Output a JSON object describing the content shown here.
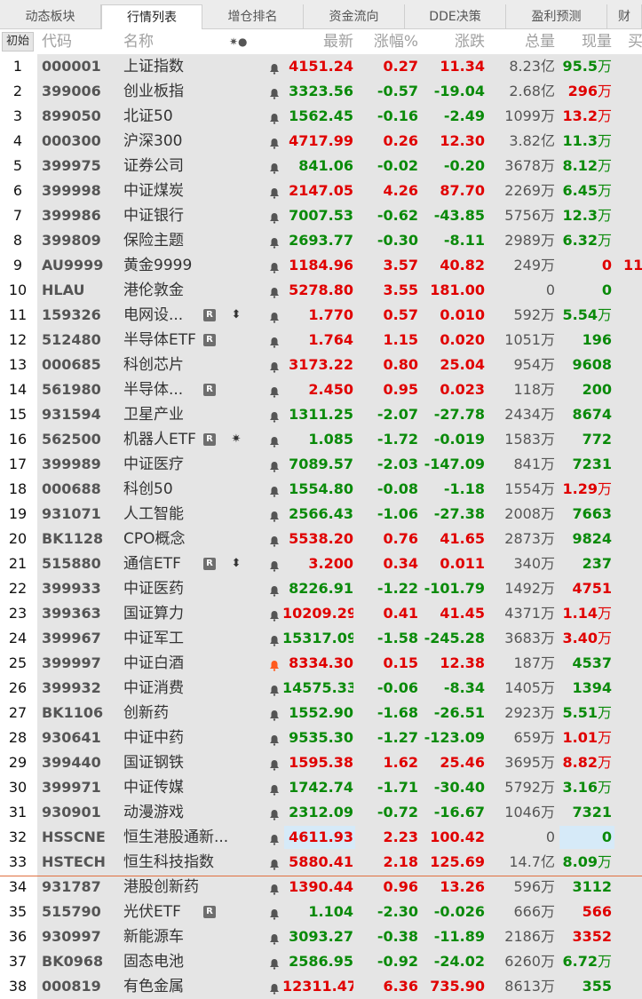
{
  "tabs": [
    "动态板块",
    "行情列表",
    "增仓排名",
    "资金流向",
    "DDE决策",
    "盈利预测",
    "财"
  ],
  "active_tab": 1,
  "header": {
    "sort": "初始",
    "code": "代码",
    "name": "名称",
    "icons": "✷●",
    "last": "最新",
    "pct": "涨幅%",
    "change": "涨跌",
    "volume": "总量",
    "current": "现量",
    "extra": "买"
  },
  "colors": {
    "up": "#e00000",
    "down": "#0a8a0a",
    "row_bg": "#e5e5e5",
    "highlight": "#d6eaf8",
    "alert_bell": "#ff5a1e"
  },
  "rows": [
    {
      "n": "1",
      "code": "000001",
      "name": "上证指数",
      "last": "4151.24",
      "pct": "0.27",
      "chg": "11.34",
      "vol": "8.23亿",
      "cur": "95.5",
      "cur_unit": "万",
      "d": "up",
      "cd": "down"
    },
    {
      "n": "2",
      "code": "399006",
      "name": "创业板指",
      "last": "3323.56",
      "pct": "-0.57",
      "chg": "-19.04",
      "vol": "2.68亿",
      "cur": "296",
      "cur_unit": "万",
      "d": "down",
      "cd": "up"
    },
    {
      "n": "3",
      "code": "899050",
      "name": "北证50",
      "last": "1562.45",
      "pct": "-0.16",
      "chg": "-2.49",
      "vol": "1099万",
      "cur": "13.2",
      "cur_unit": "万",
      "d": "down",
      "cd": "up"
    },
    {
      "n": "4",
      "code": "000300",
      "name": "沪深300",
      "last": "4717.99",
      "pct": "0.26",
      "chg": "12.30",
      "vol": "3.82亿",
      "cur": "11.3",
      "cur_unit": "万",
      "d": "up",
      "cd": "down"
    },
    {
      "n": "5",
      "code": "399975",
      "name": "证券公司",
      "last": "841.06",
      "pct": "-0.02",
      "chg": "-0.20",
      "vol": "3678万",
      "cur": "8.12",
      "cur_unit": "万",
      "d": "down",
      "cd": "down"
    },
    {
      "n": "6",
      "code": "399998",
      "name": "中证煤炭",
      "last": "2147.05",
      "pct": "4.26",
      "chg": "87.70",
      "vol": "2269万",
      "cur": "6.45",
      "cur_unit": "万",
      "d": "up",
      "cd": "down"
    },
    {
      "n": "7",
      "code": "399986",
      "name": "中证银行",
      "last": "7007.53",
      "pct": "-0.62",
      "chg": "-43.85",
      "vol": "5756万",
      "cur": "12.3",
      "cur_unit": "万",
      "d": "down",
      "cd": "down"
    },
    {
      "n": "8",
      "code": "399809",
      "name": "保险主题",
      "last": "2693.77",
      "pct": "-0.30",
      "chg": "-8.11",
      "vol": "2989万",
      "cur": "6.32",
      "cur_unit": "万",
      "d": "down",
      "cd": "down"
    },
    {
      "n": "9",
      "code": "AU9999",
      "name": "黄金9999",
      "last": "1184.96",
      "pct": "3.57",
      "chg": "40.82",
      "vol": "249万",
      "cur": "0",
      "cur_unit": "",
      "d": "up",
      "cd": "up",
      "extra": "11"
    },
    {
      "n": "10",
      "code": "HLAU",
      "name": "港伦敦金",
      "last": "5278.80",
      "pct": "3.55",
      "chg": "181.00",
      "vol": "0",
      "cur": "0",
      "cur_unit": "",
      "d": "up",
      "cd": "down"
    },
    {
      "n": "11",
      "code": "159326",
      "name": "电网设...",
      "badge": "R",
      "sym": "⬍",
      "last": "1.770",
      "pct": "0.57",
      "chg": "0.010",
      "vol": "592万",
      "cur": "5.54",
      "cur_unit": "万",
      "d": "up",
      "cd": "down"
    },
    {
      "n": "12",
      "code": "512480",
      "name": "半导体ETF",
      "badge": "R",
      "last": "1.764",
      "pct": "1.15",
      "chg": "0.020",
      "vol": "1051万",
      "cur": "196",
      "cur_unit": "",
      "d": "up",
      "cd": "down"
    },
    {
      "n": "13",
      "code": "000685",
      "name": "科创芯片",
      "last": "3173.22",
      "pct": "0.80",
      "chg": "25.04",
      "vol": "954万",
      "cur": "9608",
      "cur_unit": "",
      "d": "up",
      "cd": "down"
    },
    {
      "n": "14",
      "code": "561980",
      "name": "半导体...",
      "badge": "R",
      "last": "2.450",
      "pct": "0.95",
      "chg": "0.023",
      "vol": "118万",
      "cur": "200",
      "cur_unit": "",
      "d": "up",
      "cd": "down"
    },
    {
      "n": "15",
      "code": "931594",
      "name": "卫星产业",
      "last": "1311.25",
      "pct": "-2.07",
      "chg": "-27.78",
      "vol": "2434万",
      "cur": "8674",
      "cur_unit": "",
      "d": "down",
      "cd": "down"
    },
    {
      "n": "16",
      "code": "562500",
      "name": "机器人ETF",
      "badge": "R",
      "sym": "✷",
      "last": "1.085",
      "pct": "-1.72",
      "chg": "-0.019",
      "vol": "1583万",
      "cur": "772",
      "cur_unit": "",
      "d": "down",
      "cd": "down"
    },
    {
      "n": "17",
      "code": "399989",
      "name": "中证医疗",
      "last": "7089.57",
      "pct": "-2.03",
      "chg": "-147.09",
      "vol": "841万",
      "cur": "7231",
      "cur_unit": "",
      "d": "down",
      "cd": "down"
    },
    {
      "n": "18",
      "code": "000688",
      "name": "科创50",
      "last": "1554.80",
      "pct": "-0.08",
      "chg": "-1.18",
      "vol": "1554万",
      "cur": "1.29",
      "cur_unit": "万",
      "d": "down",
      "cd": "up"
    },
    {
      "n": "19",
      "code": "931071",
      "name": "人工智能",
      "last": "2566.43",
      "pct": "-1.06",
      "chg": "-27.38",
      "vol": "2008万",
      "cur": "7663",
      "cur_unit": "",
      "d": "down",
      "cd": "down"
    },
    {
      "n": "20",
      "code": "BK1128",
      "name": "CPO概念",
      "last": "5538.20",
      "pct": "0.76",
      "chg": "41.65",
      "vol": "2873万",
      "cur": "9824",
      "cur_unit": "",
      "d": "up",
      "cd": "down"
    },
    {
      "n": "21",
      "code": "515880",
      "name": "通信ETF",
      "badge": "R",
      "sym": "⬍",
      "last": "3.200",
      "pct": "0.34",
      "chg": "0.011",
      "vol": "340万",
      "cur": "237",
      "cur_unit": "",
      "d": "up",
      "cd": "down"
    },
    {
      "n": "22",
      "code": "399933",
      "name": "中证医药",
      "last": "8226.91",
      "pct": "-1.22",
      "chg": "-101.79",
      "vol": "1492万",
      "cur": "4751",
      "cur_unit": "",
      "d": "down",
      "cd": "up"
    },
    {
      "n": "23",
      "code": "399363",
      "name": "国证算力",
      "last": "10209.29",
      "pct": "0.41",
      "chg": "41.45",
      "vol": "4371万",
      "cur": "1.14",
      "cur_unit": "万",
      "d": "up",
      "cd": "up"
    },
    {
      "n": "24",
      "code": "399967",
      "name": "中证军工",
      "last": "15317.09",
      "pct": "-1.58",
      "chg": "-245.28",
      "vol": "3683万",
      "cur": "3.40",
      "cur_unit": "万",
      "d": "down",
      "cd": "up"
    },
    {
      "n": "25",
      "code": "399997",
      "name": "中证白酒",
      "alert": true,
      "last": "8334.30",
      "pct": "0.15",
      "chg": "12.38",
      "vol": "187万",
      "cur": "4537",
      "cur_unit": "",
      "d": "up",
      "cd": "down"
    },
    {
      "n": "26",
      "code": "399932",
      "name": "中证消费",
      "last": "14575.33",
      "pct": "-0.06",
      "chg": "-8.34",
      "vol": "1405万",
      "cur": "1394",
      "cur_unit": "",
      "d": "down",
      "cd": "down"
    },
    {
      "n": "27",
      "code": "BK1106",
      "name": "创新药",
      "last": "1552.90",
      "pct": "-1.68",
      "chg": "-26.51",
      "vol": "2923万",
      "cur": "5.51",
      "cur_unit": "万",
      "d": "down",
      "cd": "down"
    },
    {
      "n": "28",
      "code": "930641",
      "name": "中证中药",
      "last": "9535.30",
      "pct": "-1.27",
      "chg": "-123.09",
      "vol": "659万",
      "cur": "1.01",
      "cur_unit": "万",
      "d": "down",
      "cd": "up"
    },
    {
      "n": "29",
      "code": "399440",
      "name": "国证钢铁",
      "last": "1595.38",
      "pct": "1.62",
      "chg": "25.46",
      "vol": "3695万",
      "cur": "8.82",
      "cur_unit": "万",
      "d": "up",
      "cd": "up"
    },
    {
      "n": "30",
      "code": "399971",
      "name": "中证传媒",
      "last": "1742.74",
      "pct": "-1.71",
      "chg": "-30.40",
      "vol": "5792万",
      "cur": "3.16",
      "cur_unit": "万",
      "d": "down",
      "cd": "down"
    },
    {
      "n": "31",
      "code": "930901",
      "name": "动漫游戏",
      "last": "2312.09",
      "pct": "-0.72",
      "chg": "-16.67",
      "vol": "1046万",
      "cur": "7321",
      "cur_unit": "",
      "d": "down",
      "cd": "down"
    },
    {
      "n": "32",
      "code": "HSSCNE",
      "name": "恒生港股通新...",
      "last": "4611.93",
      "pct": "2.23",
      "chg": "100.42",
      "vol": "0",
      "cur": "0",
      "cur_unit": "",
      "d": "up",
      "cd": "down",
      "highlight": true
    },
    {
      "n": "33",
      "code": "HSTECH",
      "name": "恒生科技指数",
      "last": "5880.41",
      "pct": "2.18",
      "chg": "125.69",
      "vol": "14.7亿",
      "cur": "8.09",
      "cur_unit": "万",
      "d": "up",
      "cd": "down"
    },
    {
      "n": "34",
      "code": "931787",
      "name": "港股创新药",
      "last": "1390.44",
      "pct": "0.96",
      "chg": "13.26",
      "vol": "596万",
      "cur": "3112",
      "cur_unit": "",
      "d": "up",
      "cd": "down"
    },
    {
      "n": "35",
      "code": "515790",
      "name": "光伏ETF",
      "badge": "R",
      "last": "1.104",
      "pct": "-2.30",
      "chg": "-0.026",
      "vol": "666万",
      "cur": "566",
      "cur_unit": "",
      "d": "down",
      "cd": "up"
    },
    {
      "n": "36",
      "code": "930997",
      "name": "新能源车",
      "last": "3093.27",
      "pct": "-0.38",
      "chg": "-11.89",
      "vol": "2186万",
      "cur": "3352",
      "cur_unit": "",
      "d": "down",
      "cd": "up"
    },
    {
      "n": "37",
      "code": "BK0968",
      "name": "固态电池",
      "last": "2586.95",
      "pct": "-0.92",
      "chg": "-24.02",
      "vol": "6260万",
      "cur": "6.72",
      "cur_unit": "万",
      "d": "down",
      "cd": "down"
    },
    {
      "n": "38",
      "code": "000819",
      "name": "有色金属",
      "last": "12311.47",
      "pct": "6.36",
      "chg": "735.90",
      "vol": "8613万",
      "cur": "355",
      "cur_unit": "",
      "d": "up",
      "cd": "down"
    }
  ]
}
